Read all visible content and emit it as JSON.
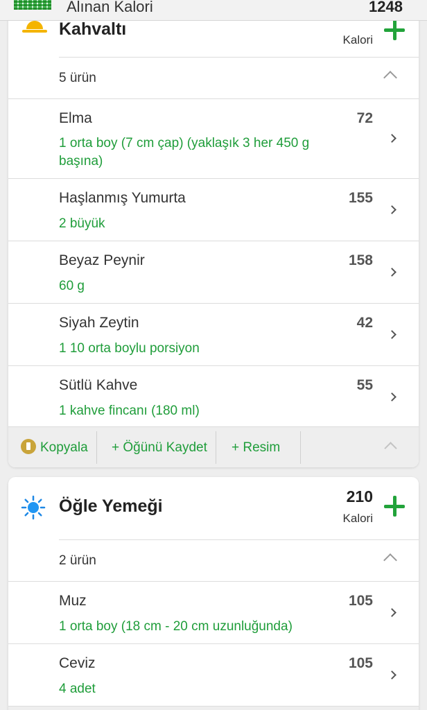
{
  "summary": {
    "label": "Alınan Kalori",
    "value": "1248"
  },
  "breakfast": {
    "title": "Kahvaltı",
    "calories": "",
    "calories_unit": "Kalori",
    "count": "5 ürün",
    "items": [
      {
        "name": "Elma",
        "calories": "72",
        "portion": "1 orta boy (7 cm çap) (yaklaşık 3 her 450 g başına)"
      },
      {
        "name": "Haşlanmış Yumurta",
        "calories": "155",
        "portion": "2 büyük"
      },
      {
        "name": "Beyaz Peynir",
        "calories": "158",
        "portion": "60 g"
      },
      {
        "name": "Siyah Zeytin",
        "calories": "42",
        "portion": "1 10 orta boylu porsiyon"
      },
      {
        "name": "Sütlü Kahve",
        "calories": "55",
        "portion": "1 kahve fincanı (180 ml)"
      }
    ],
    "actions": {
      "copy": "Kopyala",
      "save_meal": "+ Öğünü Kaydet",
      "photo": "+ Resim"
    }
  },
  "lunch": {
    "title": "Öğle Yemeği",
    "calories": "210",
    "calories_unit": "Kalori",
    "count": "2 ürün",
    "items": [
      {
        "name": "Muz",
        "calories": "105",
        "portion": "1 orta boy (18 cm - 20 cm uzunluğunda)"
      },
      {
        "name": "Ceviz",
        "calories": "105",
        "portion": "4 adet"
      }
    ]
  },
  "icons": {
    "summary": "calorie-grid-icon",
    "breakfast": "sunrise-icon",
    "lunch": "sun-icon",
    "add": "plus-icon",
    "copy": "copy-coin-icon"
  },
  "colors": {
    "accent_green": "#22a33a",
    "portion_green": "#1f9d3a",
    "background": "#eeeeee"
  }
}
